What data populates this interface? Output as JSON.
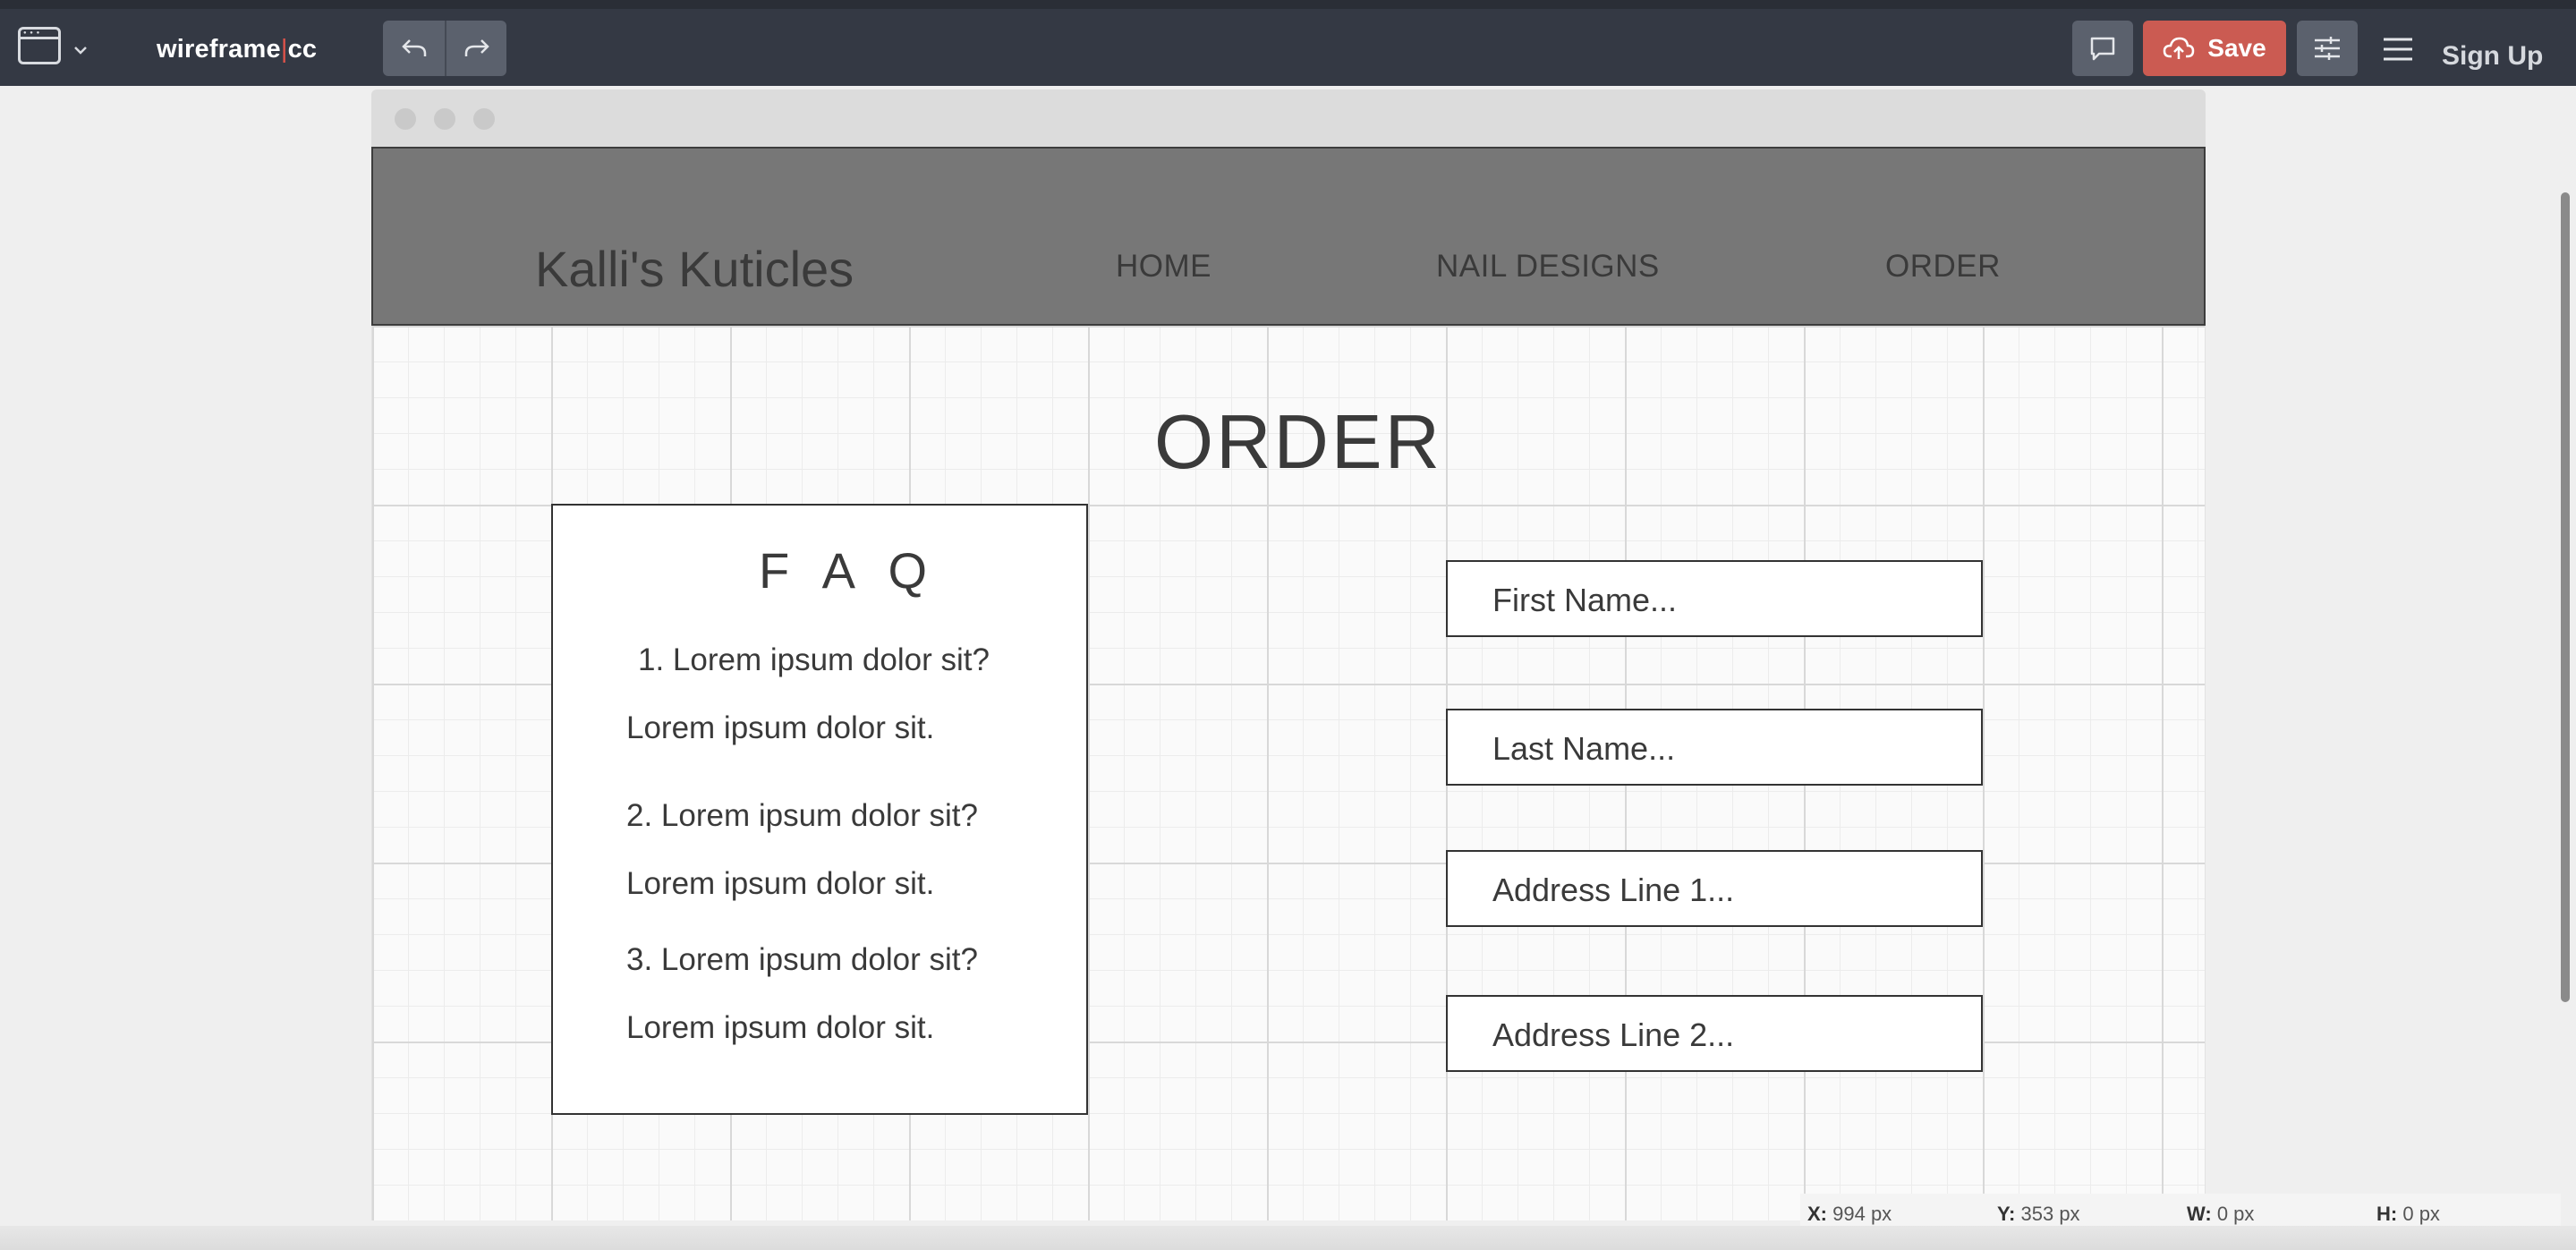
{
  "app": {
    "brand_left": "wireframe",
    "brand_sep": "|",
    "brand_right": "cc",
    "save_label": "Save",
    "signup_label": "Sign Up",
    "accent_color": "#cb5b52"
  },
  "site": {
    "title": "Kalli's Kuticles",
    "nav": [
      "HOME",
      "NAIL DESIGNS",
      "ORDER"
    ]
  },
  "page": {
    "heading": "ORDER"
  },
  "faq": {
    "title": "F A Q",
    "lines": [
      "1. Lorem ipsum dolor sit?",
      "Lorem ipsum dolor sit.",
      "2. Lorem ipsum dolor sit?",
      "Lorem ipsum dolor sit.",
      "3. Lorem ipsum dolor sit?",
      "Lorem ipsum dolor sit."
    ]
  },
  "form": {
    "fields": [
      "First Name...",
      "Last Name...",
      "Address Line 1...",
      "Address Line 2..."
    ]
  },
  "status": {
    "x_label": "X:",
    "x_value": "994 px",
    "y_label": "Y:",
    "y_value": "353 px",
    "w_label": "W:",
    "w_value": "0 px",
    "h_label": "H:",
    "h_value": "0 px"
  }
}
